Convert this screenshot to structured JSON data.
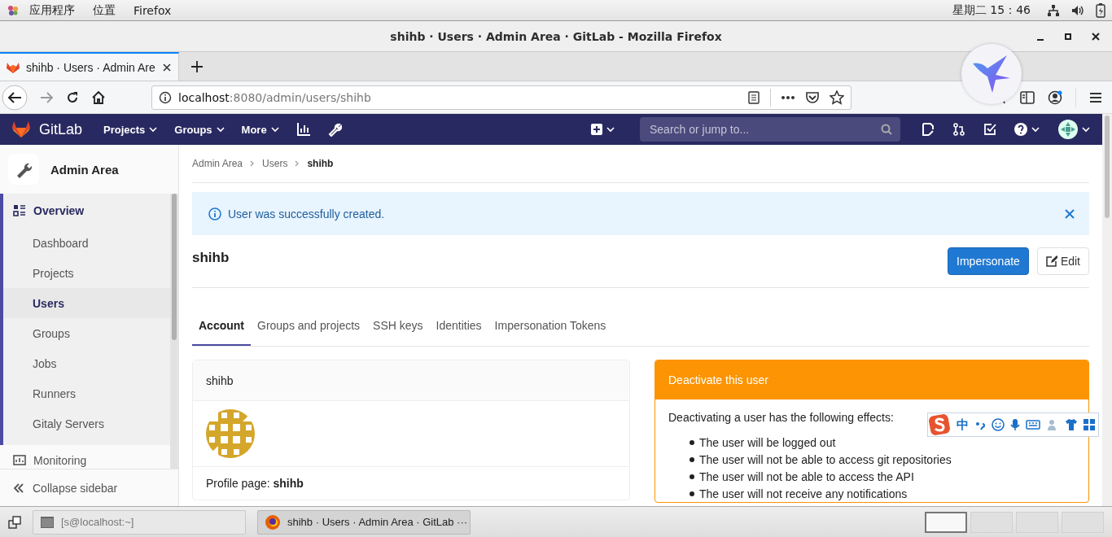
{
  "desktop_bar": {
    "menus": [
      "应用程序",
      "位置",
      "Firefox"
    ],
    "clock": "星期二 15：46"
  },
  "window": {
    "title": "shihb · Users · Admin Area · GitLab - Mozilla Firefox"
  },
  "browser_tabs": [
    {
      "title": "shihb · Users · Admin Are",
      "selected": true
    }
  ],
  "address_bar": {
    "host": "localhost",
    "path": ":8080/admin/users/shihb"
  },
  "gitlab_nav": {
    "brand": "GitLab",
    "menus": [
      "Projects",
      "Groups",
      "More"
    ],
    "search": {
      "placeholder": "Search or jump to..."
    }
  },
  "sidebar": {
    "title": "Admin Area",
    "items": [
      {
        "label": "Overview",
        "selected": true,
        "children": [
          {
            "label": "Dashboard",
            "selected": false
          },
          {
            "label": "Projects",
            "selected": false
          },
          {
            "label": "Users",
            "selected": true
          },
          {
            "label": "Groups",
            "selected": false
          },
          {
            "label": "Jobs",
            "selected": false
          },
          {
            "label": "Runners",
            "selected": false
          },
          {
            "label": "Gitaly Servers",
            "selected": false
          }
        ]
      },
      {
        "label": "Monitoring",
        "selected": false
      }
    ],
    "collapse": "Collapse sidebar"
  },
  "breadcrumbs": [
    "Admin Area",
    "Users",
    "shihb"
  ],
  "alert": {
    "message": "User was successfully created."
  },
  "user_heading": "shihb",
  "buttons": [
    {
      "label": "Impersonate",
      "kind": "primary"
    },
    {
      "label": "Edit",
      "kind": "edit"
    }
  ],
  "tabs": [
    {
      "label": "Account",
      "selected": true
    },
    {
      "label": "Groups and projects",
      "selected": false
    },
    {
      "label": "SSH keys",
      "selected": false
    },
    {
      "label": "Identities",
      "selected": false
    },
    {
      "label": "Impersonation Tokens",
      "selected": false
    }
  ],
  "profile_card": {
    "name": "shihb",
    "profile_page": "Profile page: **shihb**"
  },
  "deactivate_panel": {
    "title": "Deactivate this user",
    "intro": "Deactivating a user has the following effects:",
    "effects": [
      "The user will be logged out",
      "The user will not be able to access git repositories",
      "The user will not be able to access the API",
      "The user will not receive any notifications"
    ]
  },
  "ime_toolbar": {
    "mode": "中"
  },
  "taskbar": {
    "windows": [
      {
        "title": "[s@localhost:~]",
        "selected": false
      },
      {
        "title": "shihb · Users · Admin Area · GitLab ···",
        "selected": true
      }
    ],
    "workspaces": [
      {
        "selected": true
      },
      {
        "selected": false
      },
      {
        "selected": false
      },
      {
        "selected": false
      }
    ]
  }
}
